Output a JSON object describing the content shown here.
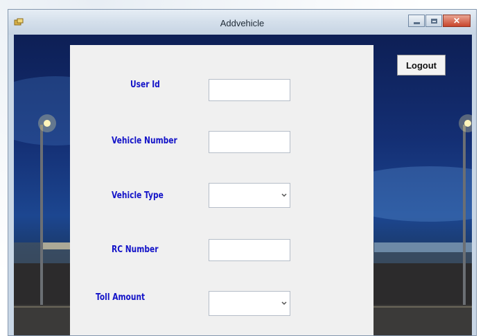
{
  "window": {
    "title": "Addvehicle",
    "icons": {
      "app": "app-icon",
      "minimize": "minimize-icon",
      "maximize": "maximize-icon",
      "close": "close-icon"
    }
  },
  "logout_label": "Logout",
  "form": {
    "user_id_label": "User Id",
    "user_id_value": "",
    "vehicle_number_label": "Vehicle Number",
    "vehicle_number_value": "",
    "vehicle_type_label": "Vehicle Type",
    "vehicle_type_value": "",
    "rc_number_label": "RC Number",
    "rc_number_value": "",
    "toll_amount_label": "Toll Amount",
    "toll_amount_value": ""
  },
  "colors": {
    "label_text": "#1414c8",
    "panel_bg": "#f0f0f0",
    "night_sky": "#142f74"
  }
}
